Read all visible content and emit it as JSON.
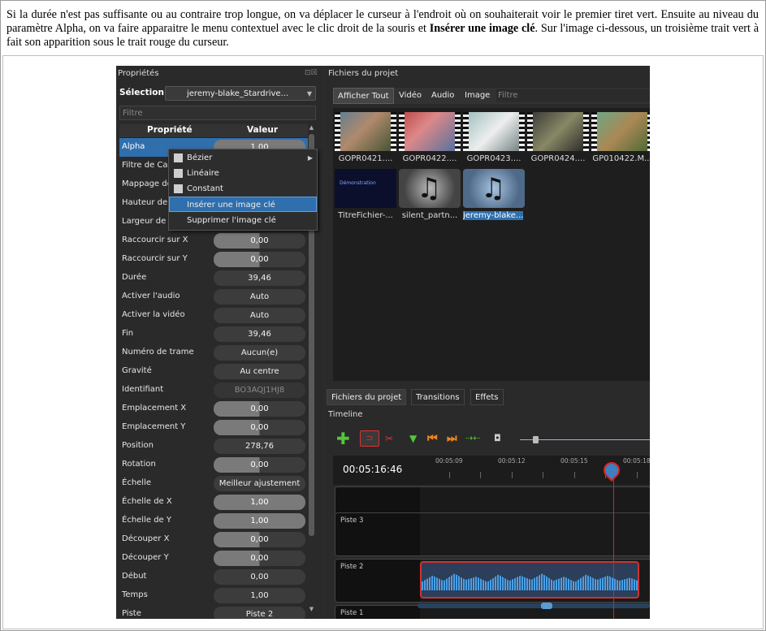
{
  "intro": {
    "line1": "Si la durée n'est pas suffisante ou au contraire trop longue, on va déplacer le curseur à l'endroit où on souhaiterait voir le premier tiret vert. Ensuite au niveau du paramètre Alpha, on va faire apparaitre le menu contextuel avec le clic droit de la souris et ",
    "bold": "Insérer une image clé",
    "line2": ". Sur l'image ci-dessous, un troisième trait vert à fait son apparition sous le trait rouge du curseur."
  },
  "properties_panel": {
    "title": "Propriétés",
    "title_icons": "⊡☒",
    "selection_label": "Sélection :",
    "selection_value": "jeremy-blake_Stardrive...",
    "filter_placeholder": "Filtre",
    "col_property": "Propriété",
    "col_value": "Valeur",
    "rows": [
      {
        "label": "Alpha",
        "value": "1,00",
        "level": 1.0
      },
      {
        "label": "Filtre de Car",
        "value": ""
      },
      {
        "label": "Mappage de",
        "value": ""
      },
      {
        "label": "Hauteur de",
        "value": ""
      },
      {
        "label": "Largeur de r",
        "value": ""
      },
      {
        "label": "Raccourcir sur X",
        "value": "0,00",
        "level": 0.5
      },
      {
        "label": "Raccourcir sur Y",
        "value": "0,00",
        "level": 0.5
      },
      {
        "label": "Durée",
        "value": "39,46"
      },
      {
        "label": "Activer l'audio",
        "value": "Auto"
      },
      {
        "label": "Activer la vidéo",
        "value": "Auto"
      },
      {
        "label": "Fin",
        "value": "39,46"
      },
      {
        "label": "Numéro de trame",
        "value": "Aucun(e)"
      },
      {
        "label": "Gravité",
        "value": "Au centre"
      },
      {
        "label": "Identifiant",
        "value": "BO3AQJ1HJ8"
      },
      {
        "label": "Emplacement X",
        "value": "0,00",
        "level": 0.5
      },
      {
        "label": "Emplacement Y",
        "value": "0,00",
        "level": 0.5
      },
      {
        "label": "Position",
        "value": "278,76"
      },
      {
        "label": "Rotation",
        "value": "0,00",
        "level": 0.5
      },
      {
        "label": "Échelle",
        "value": "Meilleur ajustement"
      },
      {
        "label": "Échelle de X",
        "value": "1,00",
        "level": 1.0
      },
      {
        "label": "Échelle de Y",
        "value": "1,00",
        "level": 1.0
      },
      {
        "label": "Découper X",
        "value": "0,00",
        "level": 0.5
      },
      {
        "label": "Découper Y",
        "value": "0,00",
        "level": 0.5
      },
      {
        "label": "Début",
        "value": "0,00"
      },
      {
        "label": "Temps",
        "value": "1,00"
      },
      {
        "label": "Piste",
        "value": "Piste 2"
      }
    ]
  },
  "context_menu": {
    "items": [
      {
        "label": "Bézier",
        "has_submenu": true
      },
      {
        "label": "Linéaire"
      },
      {
        "label": "Constant"
      },
      {
        "label": "Insérer une image clé",
        "highlighted": true
      },
      {
        "label": "Supprimer l'image clé"
      }
    ]
  },
  "project_files": {
    "title": "Fichiers du projet",
    "tabs": [
      "Afficher Tout",
      "Vidéo",
      "Audio",
      "Image"
    ],
    "filter_placeholder": "Filtre",
    "files": [
      {
        "name": "GOPR0421...."
      },
      {
        "name": "GOPR0422...."
      },
      {
        "name": "GOPR0423...."
      },
      {
        "name": "GOPR0424...."
      },
      {
        "name": "GP010422.M..."
      },
      {
        "name": "TitreFichier-..."
      },
      {
        "name": "silent_partn..."
      },
      {
        "name": "jeremy-blake..."
      }
    ],
    "title_thumb_text": "Démonstration"
  },
  "bottom_tabs": [
    "Fichiers du projet",
    "Transitions",
    "Effets"
  ],
  "timeline": {
    "title": "Timeline",
    "timecode": "00:05:16:46",
    "ticks": [
      "00:05:09",
      "00:05:12",
      "00:05:15",
      "00:05:18"
    ],
    "tracks": [
      "Piste 3",
      "Piste 2",
      "Piste 1"
    ]
  },
  "colors": {
    "accent": "#2f6fad",
    "playhead": "#dd2222",
    "add_green": "#55c63a"
  }
}
